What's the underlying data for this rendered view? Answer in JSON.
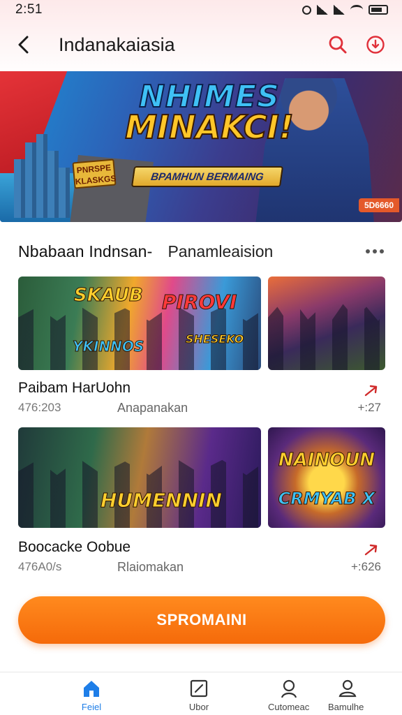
{
  "status_bar": {
    "time": "2:51"
  },
  "header": {
    "title": "Indanakaiasia",
    "back_icon": "chevron-left-icon",
    "search_icon": "search-icon",
    "download_icon": "download-icon",
    "accent": "#e0303a"
  },
  "hero": {
    "title_line1": "NHIMES",
    "title_line2": "MINAKCI!",
    "subtitle": "BPAMHUN BERMAING",
    "badge": "PNRSPE KLASKGS",
    "corner_tag": "5D6660"
  },
  "section": {
    "title": "Nbabaan Indnsan-",
    "subtitle": "Panamleaision",
    "more_icon": "more-dots-icon"
  },
  "rows": [
    {
      "thumb_main_labels": [
        "SKAUB",
        "PIROVI",
        "YKINNOS",
        "SHESEKO"
      ],
      "title": "Paibam HarUohn",
      "meta": "476:203",
      "meta2": "Anapanakan",
      "right": "+:27",
      "arrow_icon": "trending-arrow-icon"
    },
    {
      "thumb_main_labels": [
        "HUMENNIN"
      ],
      "thumb_side_labels": [
        "NAINOUN",
        "CRMYAB X"
      ],
      "title": "Boocacke Oobue",
      "meta": "476A0/s",
      "meta2": "Rlaiomakan",
      "right": "+:626",
      "arrow_icon": "trending-arrow-icon"
    }
  ],
  "cta": {
    "label": "SPROMAINI",
    "color": "#f5780f"
  },
  "bottom_nav": {
    "items": [
      {
        "label": "Feiel",
        "icon": "home-icon",
        "active": true
      },
      {
        "label": "Ubor",
        "icon": "edit-box-icon",
        "active": false
      },
      {
        "label": "Cutomeac",
        "icon": "person-icon",
        "active": false
      },
      {
        "label": "Bamulhe",
        "icon": "people-icon",
        "active": false
      }
    ],
    "active_color": "#1e7ee8"
  }
}
